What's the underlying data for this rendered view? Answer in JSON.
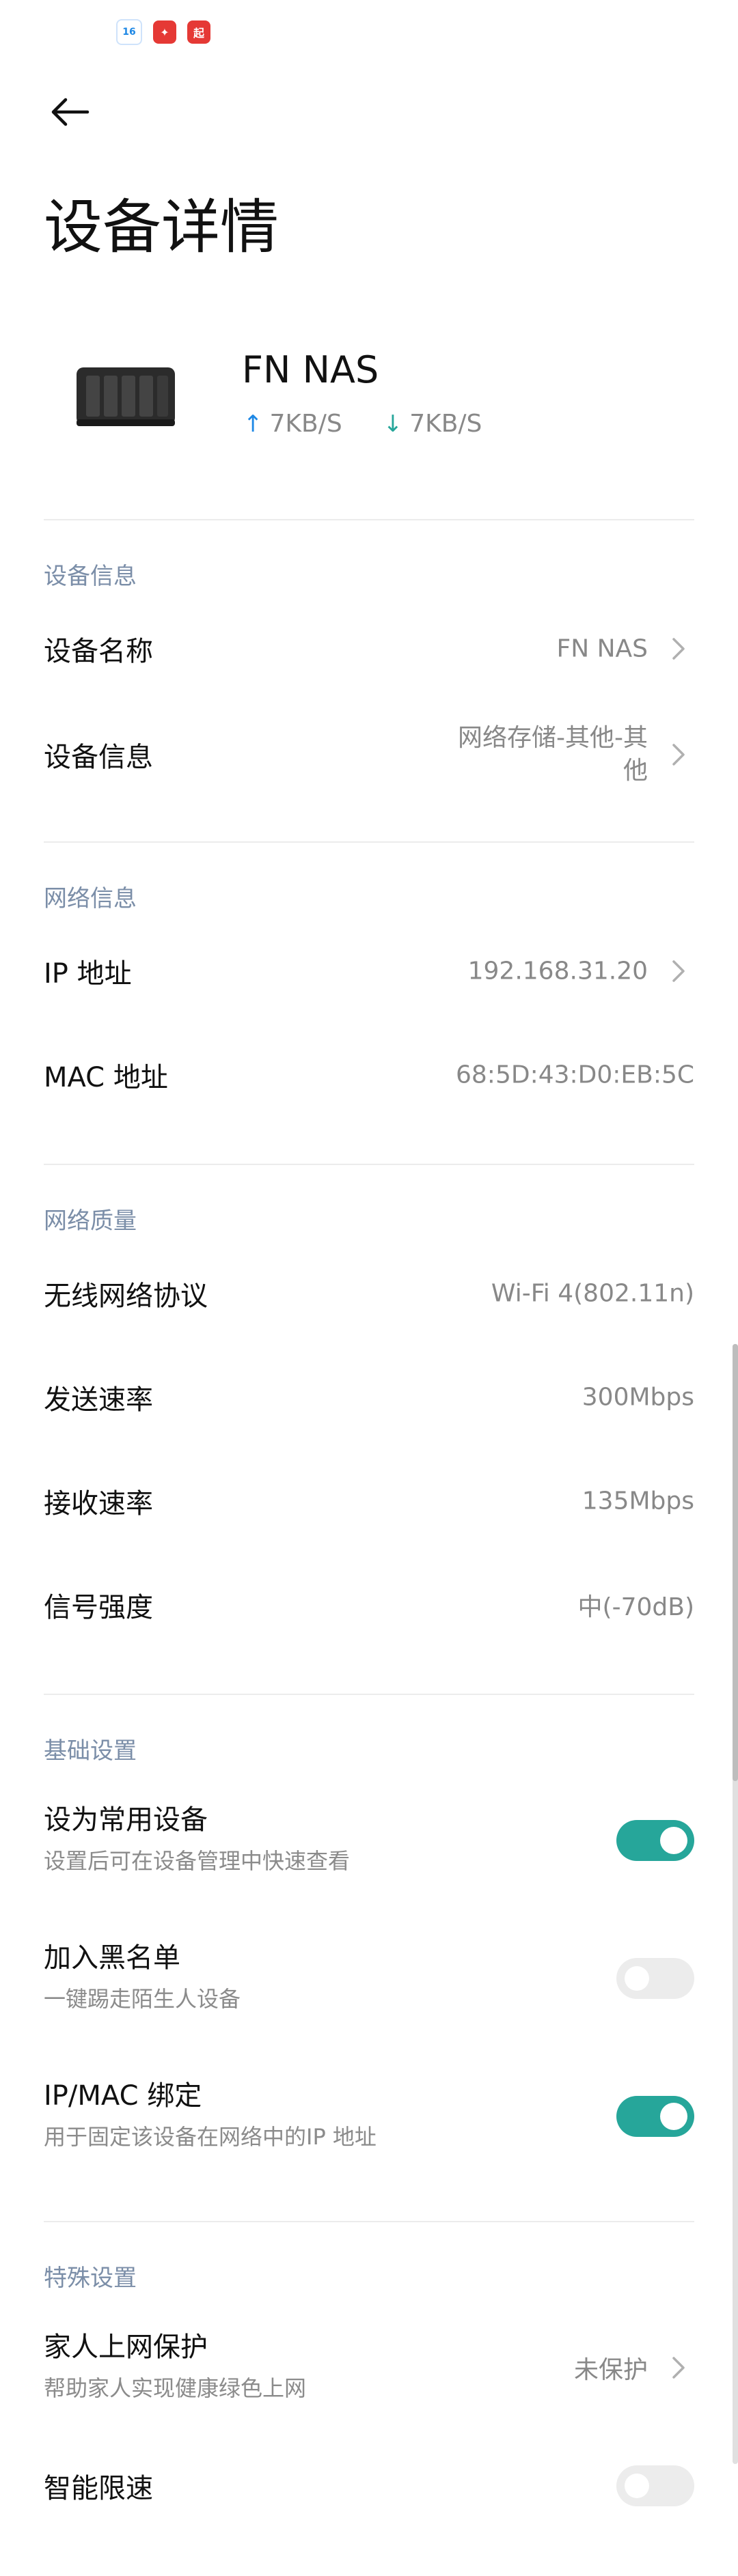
{
  "status_icons": [
    {
      "name": "app-16-icon",
      "text": "16"
    },
    {
      "name": "app-red-icon",
      "text": "✦"
    },
    {
      "name": "app-red2-icon",
      "text": "起"
    }
  ],
  "header": {
    "back_icon": "arrow-left-icon",
    "title": "设备详情"
  },
  "device": {
    "name": "FN NAS",
    "upload": "7KB/S",
    "download": "7KB/S",
    "icon": "nas-device-icon"
  },
  "sections": {
    "device_info": {
      "title": "设备信息",
      "rows": [
        {
          "label": "设备名称",
          "value": "FN NAS"
        },
        {
          "label": "设备信息",
          "value_line1": "网络存储-其他-其",
          "value_line2": "他"
        }
      ]
    },
    "network_info": {
      "title": "网络信息",
      "rows": [
        {
          "label": "IP 地址",
          "value": "192.168.31.20"
        },
        {
          "label": "MAC 地址",
          "value": "68:5D:43:D0:EB:5C"
        }
      ]
    },
    "network_quality": {
      "title": "网络质量",
      "rows": [
        {
          "label": "无线网络协议",
          "value": "Wi-Fi 4(802.11n)"
        },
        {
          "label": "发送速率",
          "value": "300Mbps"
        },
        {
          "label": "接收速率",
          "value": "135Mbps"
        },
        {
          "label": "信号强度",
          "value": "中(-70dB)"
        }
      ]
    },
    "basic_settings": {
      "title": "基础设置",
      "rows": [
        {
          "label": "设为常用设备",
          "sub": "设置后可在设备管理中快速查看",
          "on": true
        },
        {
          "label": "加入黑名单",
          "sub": "一键踢走陌生人设备",
          "on": false
        },
        {
          "label": "IP/MAC 绑定",
          "sub": "用于固定该设备在网络中的IP 地址",
          "on": true
        }
      ]
    },
    "special_settings": {
      "title": "特殊设置",
      "rows": [
        {
          "label": "家人上网保护",
          "sub": "帮助家人实现健康绿色上网",
          "value": "未保护"
        },
        {
          "label": "智能限速",
          "on": false
        }
      ]
    }
  },
  "colors": {
    "accent": "#26a69a",
    "section_title": "#7b8ea8",
    "upload_arrow": "#1e88e5"
  }
}
